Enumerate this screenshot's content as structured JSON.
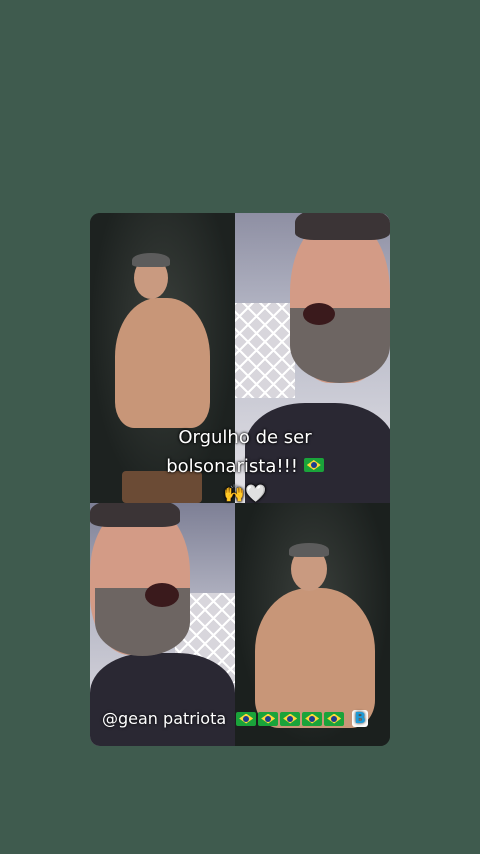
{
  "video": {
    "caption_line1": "Orgulho de ser",
    "caption_line2": "bolsonarista!!!",
    "caption_emojis": "🙌🤍",
    "watermark_handle": "@gean patriota",
    "watermark_badge": "B"
  },
  "colors": {
    "background": "#3f5b4e",
    "caption_text": "#ffffff",
    "badge_blue": "#1e9ad6"
  },
  "icons": [
    "brazil-flag-icon",
    "raised-hands-icon",
    "white-heart-icon",
    "b-badge-icon"
  ]
}
